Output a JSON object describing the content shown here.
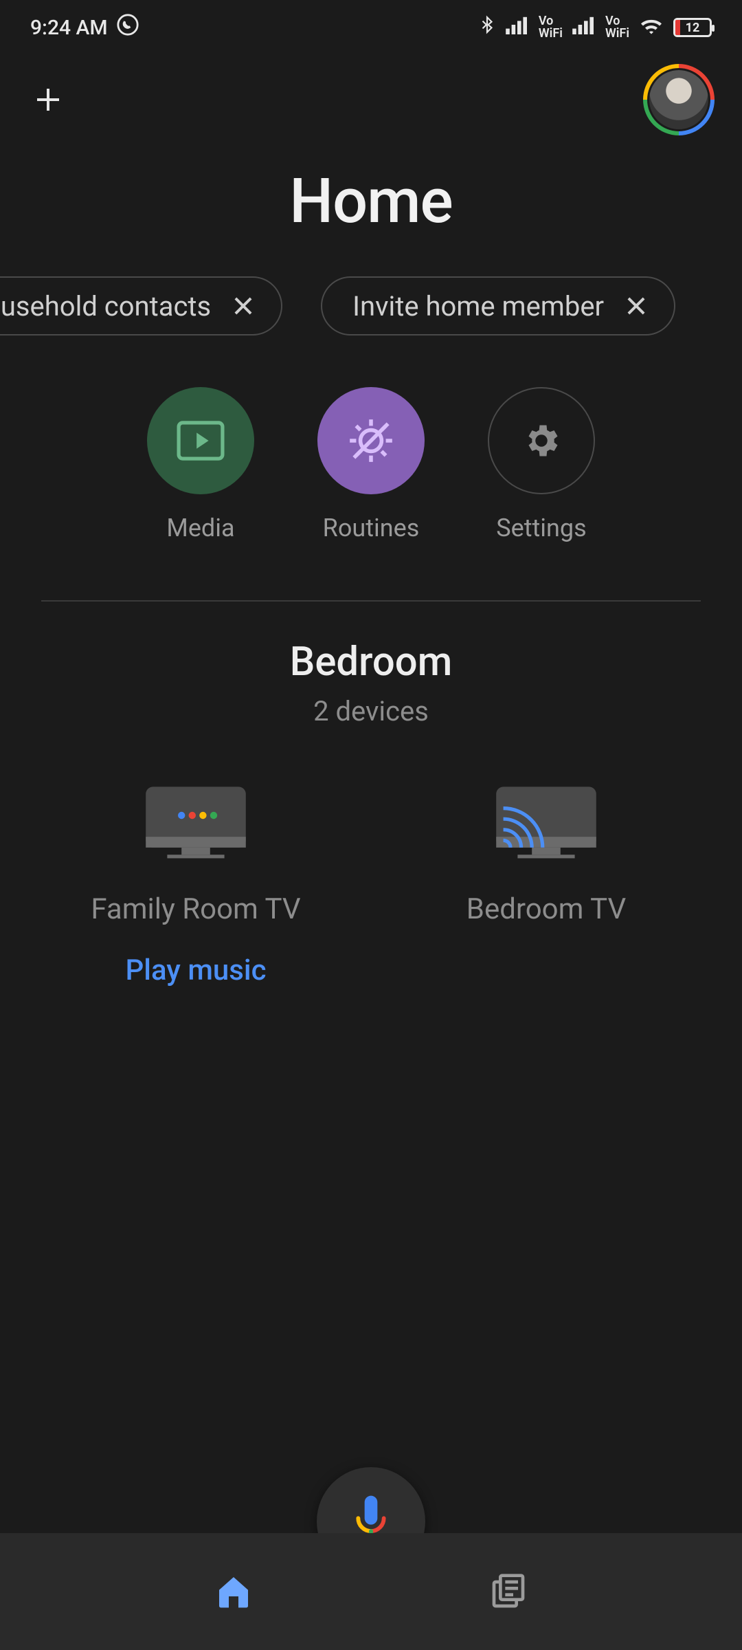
{
  "status": {
    "time": "9:24 AM",
    "battery_percent": "12"
  },
  "header": {
    "title": "Home"
  },
  "chips": [
    {
      "label": "household contacts"
    },
    {
      "label": "Invite home member"
    }
  ],
  "quick_actions": {
    "media": {
      "label": "Media"
    },
    "routines": {
      "label": "Routines"
    },
    "settings": {
      "label": "Settings"
    }
  },
  "room": {
    "name": "Bedroom",
    "subtitle": "2 devices",
    "devices": [
      {
        "label": "Family Room TV",
        "action": "Play music"
      },
      {
        "label": "Bedroom TV"
      }
    ]
  }
}
